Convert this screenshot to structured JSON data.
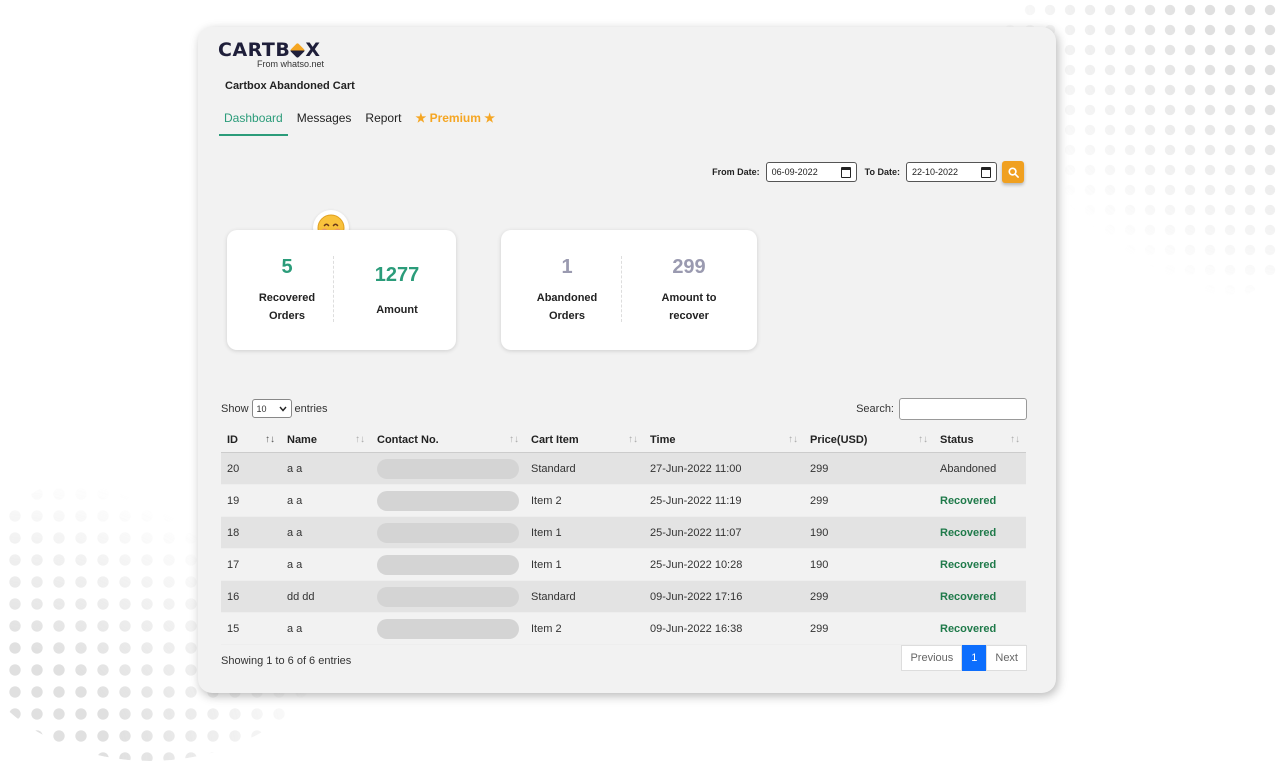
{
  "brand": {
    "logo": "CARTB",
    "logo_end": "X",
    "subtitle": "From whatso.net"
  },
  "app_title": "Cartbox Abandoned Cart",
  "tabs": {
    "dashboard": "Dashboard",
    "messages": "Messages",
    "report": "Report",
    "premium": "Premium"
  },
  "date_filter": {
    "from_label": "From Date:",
    "from_value": "06-09-2022",
    "to_label": "To Date:",
    "to_value": "22-10-2022"
  },
  "stats": {
    "recovered_orders": "5",
    "recovered_orders_label_1": "Recovered",
    "recovered_orders_label_2": "Orders",
    "amount": "1277",
    "amount_label": "Amount",
    "abandoned_orders": "1",
    "abandoned_orders_label_1": "Abandoned",
    "abandoned_orders_label_2": "Orders",
    "amount_to_recover": "299",
    "amount_to_recover_label_1": "Amount to",
    "amount_to_recover_label_2": "recover"
  },
  "table_controls": {
    "show_label": "Show",
    "page_size": "10",
    "entries_label": "entries",
    "search_label": "Search:"
  },
  "table": {
    "headers": [
      "ID",
      "Name",
      "Contact No.",
      "Cart Item",
      "Time",
      "Price(USD)",
      "Status"
    ],
    "rows": [
      {
        "id": "20",
        "name": "a a",
        "cart_item": "Standard",
        "time": "27-Jun-2022 11:00",
        "price": "299",
        "status": "Abandoned"
      },
      {
        "id": "19",
        "name": "a a",
        "cart_item": "Item 2",
        "time": "25-Jun-2022 11:19",
        "price": "299",
        "status": "Recovered"
      },
      {
        "id": "18",
        "name": "a a",
        "cart_item": "Item 1",
        "time": "25-Jun-2022 11:07",
        "price": "190",
        "status": "Recovered"
      },
      {
        "id": "17",
        "name": "a a",
        "cart_item": "Item 1",
        "time": "25-Jun-2022 10:28",
        "price": "190",
        "status": "Recovered"
      },
      {
        "id": "16",
        "name": "dd dd",
        "cart_item": "Standard",
        "time": "09-Jun-2022 17:16",
        "price": "299",
        "status": "Recovered"
      },
      {
        "id": "15",
        "name": "a a",
        "cart_item": "Item 2",
        "time": "09-Jun-2022 16:38",
        "price": "299",
        "status": "Recovered"
      }
    ]
  },
  "footer": {
    "info": "Showing 1 to 6 of 6 entries",
    "previous": "Previous",
    "current_page": "1",
    "next": "Next"
  },
  "colors": {
    "accent": "#2b9c7a",
    "premium": "#f5a623",
    "recovered": "#1f7a4a",
    "page_active": "#0d6efd"
  }
}
